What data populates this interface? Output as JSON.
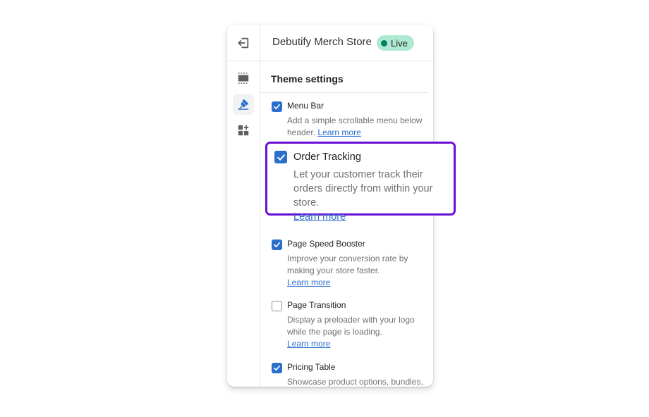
{
  "header": {
    "store_name": "Debutify Merch Store",
    "status_badge": "Live",
    "exit_icon": "exit-icon"
  },
  "sidebar_rail": {
    "items": [
      {
        "icon": "sections-icon",
        "active": false
      },
      {
        "icon": "theme-brush-icon",
        "active": true
      },
      {
        "icon": "apps-blocks-icon",
        "active": false
      }
    ]
  },
  "main": {
    "section_title": "Theme settings",
    "settings": [
      {
        "label": "Menu Bar",
        "description": "Add a simple scrollable menu below header.",
        "link": "Learn more",
        "checked": true
      },
      {
        "label": "Page Speed Booster",
        "description": "Improve your conversion rate by making your store faster.",
        "link": "Learn more",
        "checked": true
      },
      {
        "label": "Page Transition",
        "description": "Display a preloader with your logo while the page is loading.",
        "link": "Learn more",
        "checked": false
      },
      {
        "label": "Pricing Table",
        "description": "Showcase product options, bundles, packages and all other upgrade",
        "checked": true
      }
    ]
  },
  "highlight": {
    "label": "Order Tracking",
    "description": "Let your customer track their orders directly from within your store.",
    "link": "Learn more",
    "checked": true
  },
  "colors": {
    "accent_blue": "#2c6ecb",
    "callout_border": "#6a0fd6",
    "live_badge_bg": "#aee9d1",
    "live_dot": "#007f5f"
  }
}
